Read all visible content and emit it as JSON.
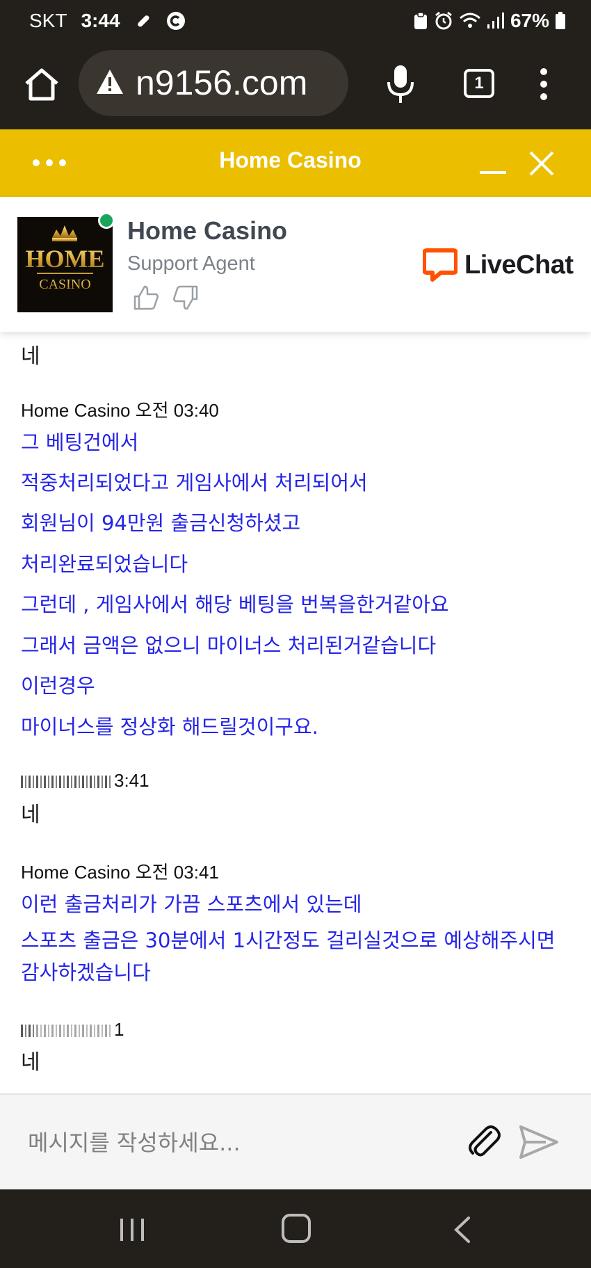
{
  "status_bar": {
    "carrier": "SKT",
    "time": "3:44",
    "battery": "67%"
  },
  "browser": {
    "url": "n9156.com",
    "tab_count": "1"
  },
  "chat_header": {
    "title": "Home Casino"
  },
  "agent": {
    "name": "Home Casino",
    "role": "Support Agent",
    "avatar_line1": "HOME",
    "avatar_line2": "CASINO",
    "brand": "LiveChat"
  },
  "messages": {
    "m0_text": "네",
    "m1_meta": "Home Casino 오전 03:40",
    "m1_lines": [
      "그 베팅건에서",
      "적중처리되었다고 게임사에서 처리되어서",
      "회원님이 94만원 출금신청하셨고",
      "처리완료되었습니다",
      "그런데 , 게임사에서 해당 베팅을 번복을한거같아요",
      "그래서 금액은 없으니 마이너스 처리된거같습니다",
      "이런경우",
      "마이너스를 정상화 해드릴것이구요."
    ],
    "m2_time": "3:41",
    "m2_text": "네",
    "m3_meta": "Home Casino 오전 03:41",
    "m3_lines": [
      "이런 출금처리가 가끔 스포츠에서 있는데",
      "스포츠 출금은 30분에서 1시간정도 걸리실것으로 예상해주시면 감사하겠습니다"
    ],
    "m4_time": "1",
    "m4_text": "네"
  },
  "composer": {
    "placeholder": "메시지를 작성하세요..."
  },
  "colors": {
    "header_yellow": "#ebbe00",
    "agent_text_blue": "#2424e8",
    "online_green": "#1aa65a",
    "livechat_orange": "#ff5100",
    "dark_chrome": "#231f1b"
  }
}
